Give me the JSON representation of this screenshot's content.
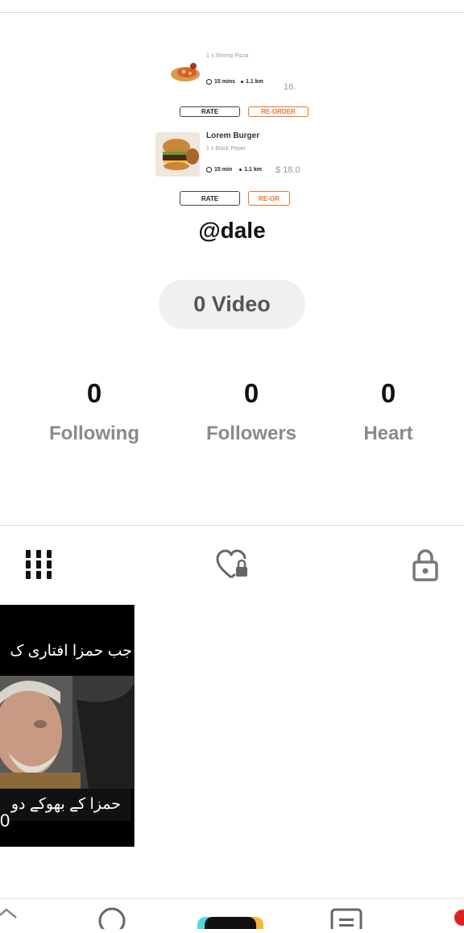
{
  "profile": {
    "username": "@dale",
    "video_label": "0 Video",
    "stats": [
      {
        "value": "0",
        "label": "Following"
      },
      {
        "value": "0",
        "label": "Followers"
      },
      {
        "value": "0",
        "label": "Heart"
      }
    ]
  },
  "avatar_image": {
    "orders": [
      {
        "name": "",
        "desc": "1 x Shrimp Pizza",
        "time": "15 mins",
        "distance": "1.1 km",
        "price": "16.",
        "rate": "RATE",
        "reorder": "RE-ORDER"
      },
      {
        "name": "Lorem Burger",
        "desc": "1 x Black Peper",
        "time": "15 min",
        "distance": "1.1 km",
        "price": "$ 18.0",
        "rate": "RATE",
        "reorder": "RE-OR"
      }
    ]
  },
  "tabs": [
    {
      "icon": "grid-icon"
    },
    {
      "icon": "liked-private-icon"
    },
    {
      "icon": "lock-icon"
    }
  ],
  "videos": [
    {
      "caption_top": "جب حمزا افتاری ک",
      "caption_bottom": "حمزا کے بھوکے دو",
      "views": "0"
    }
  ],
  "colors": {
    "accent": "#e8732c",
    "muted": "#8a8a8a",
    "pill": "#f0f0f0"
  }
}
